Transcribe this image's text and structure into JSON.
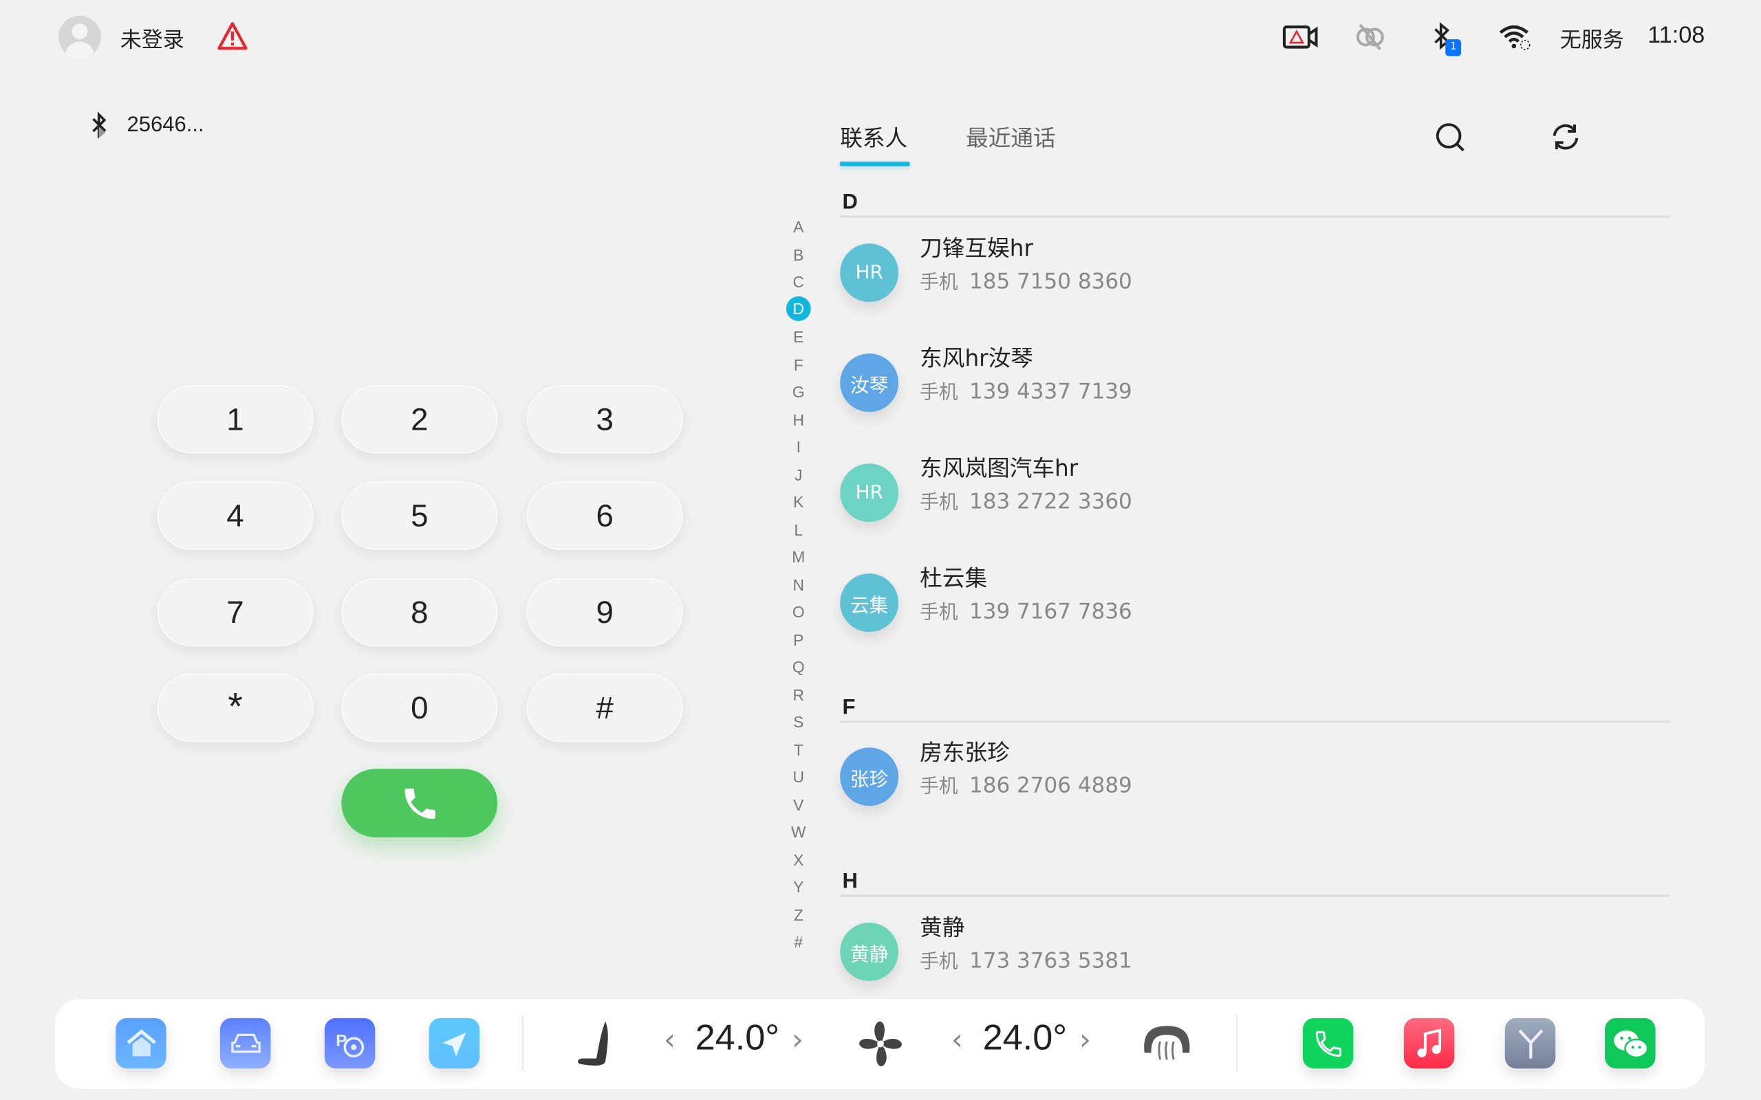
{
  "status_bar": {
    "login_text": "未登录",
    "signal_text": "无服务",
    "time": "11:08",
    "bluetooth_badge": "1",
    "icons": [
      "avatar-icon",
      "warning-icon",
      "camera-warning-icon",
      "link-off-icon",
      "bluetooth-icon",
      "wifi-icon"
    ]
  },
  "dialer": {
    "device_name": "25646...",
    "keys": [
      "1",
      "2",
      "3",
      "4",
      "5",
      "6",
      "7",
      "8",
      "9",
      "*",
      "0",
      "#"
    ],
    "call_icon": "phone-icon"
  },
  "tabs": [
    {
      "label": "联系人",
      "active": true
    },
    {
      "label": "最近通话",
      "active": false
    }
  ],
  "accent_color": "#10b8e0",
  "index_letters": [
    "A",
    "B",
    "C",
    "D",
    "E",
    "F",
    "G",
    "H",
    "I",
    "J",
    "K",
    "L",
    "M",
    "N",
    "O",
    "P",
    "Q",
    "R",
    "S",
    "T",
    "U",
    "V",
    "W",
    "X",
    "Y",
    "Z",
    "#"
  ],
  "index_active": "D",
  "phone_label": "手机",
  "sections": [
    {
      "letter": "D",
      "contacts": [
        {
          "avatar": "HR",
          "name": "刀锋互娱hr",
          "phone": "185 7150 8360",
          "color": "#5ec1d6"
        },
        {
          "avatar": "汝琴",
          "name": "东风hr汝琴",
          "phone": "139 4337 7139",
          "color": "#5ea6e6"
        },
        {
          "avatar": "HR",
          "name": "东风岚图汽车hr",
          "phone": "183 2722 3360",
          "color": "#6dd4c4"
        },
        {
          "avatar": "云集",
          "name": "杜云集",
          "phone": "139 7167 7836",
          "color": "#5ec1d6"
        }
      ]
    },
    {
      "letter": "F",
      "contacts": [
        {
          "avatar": "张珍",
          "name": "房东张珍",
          "phone": "186 2706 4889",
          "color": "#5ea6e6"
        }
      ]
    },
    {
      "letter": "H",
      "contacts": [
        {
          "avatar": "黄静",
          "name": "黄静",
          "phone": "173 3763 5381",
          "color": "#6dd4b8"
        }
      ]
    }
  ],
  "dock": {
    "left_temp": "24.0°",
    "right_temp": "24.0°",
    "apps_left": [
      "home-app",
      "car-app",
      "driving-app",
      "navigation-app"
    ],
    "apps_right": [
      "phone-app",
      "music-app",
      "brand-app",
      "wechat-app"
    ]
  }
}
